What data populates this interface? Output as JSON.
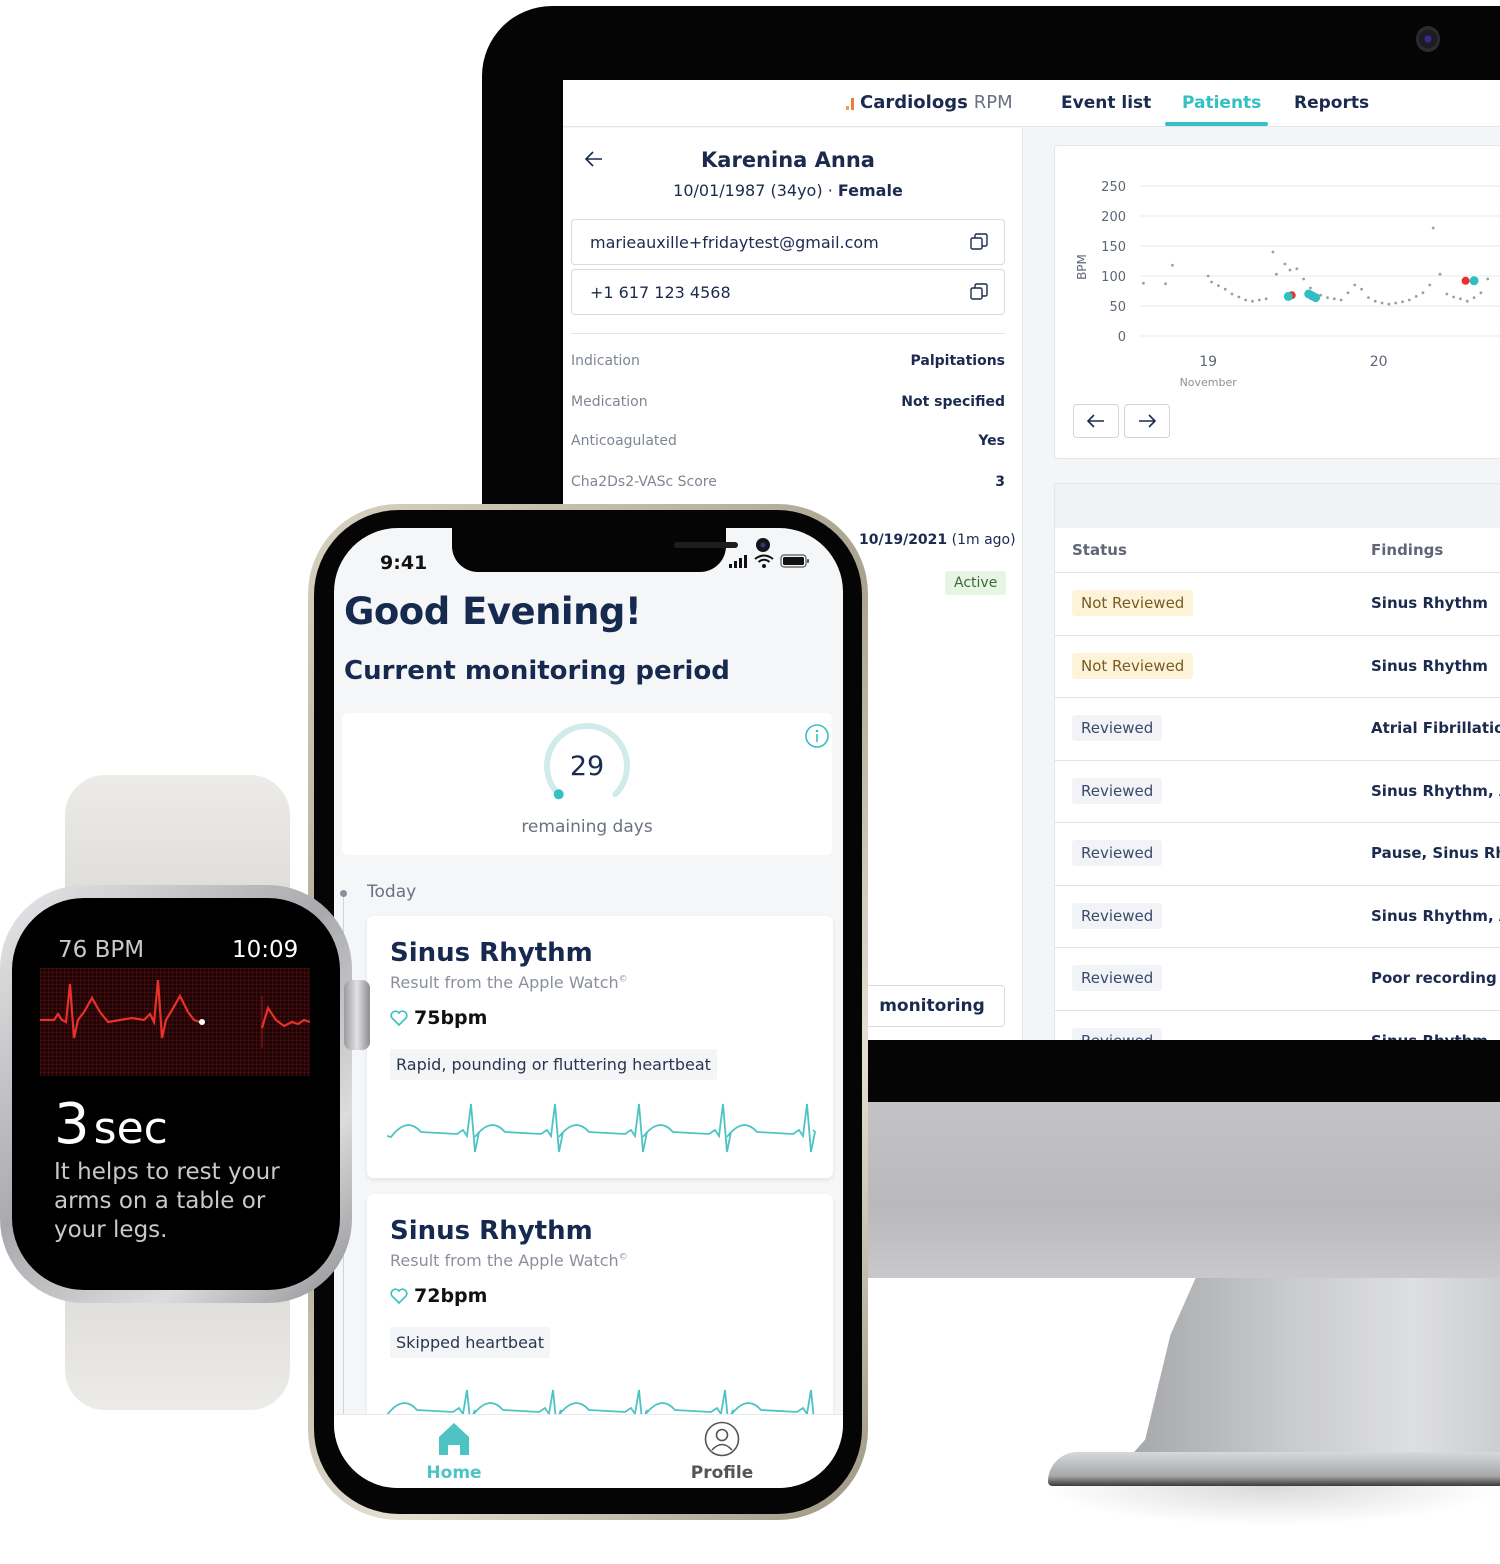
{
  "desktop": {
    "brand": {
      "name": "Cardiologs",
      "suffix": "RPM"
    },
    "nav_tabs": [
      {
        "label": "Event list",
        "active": false
      },
      {
        "label": "Patients",
        "active": true
      },
      {
        "label": "Reports",
        "active": false
      }
    ],
    "patient": {
      "name": "Karenina Anna",
      "dob": "10/01/1987",
      "age": "(34yo)",
      "separator": "·",
      "sex": "Female",
      "email": "marieauxille+fridaytest@gmail.com",
      "phone": "+1 617 123 4568",
      "details": [
        {
          "label": "Indication",
          "value": "Palpitations"
        },
        {
          "label": "Medication",
          "value": "Not specified"
        },
        {
          "label": "Anticoagulated",
          "value": "Yes"
        },
        {
          "label": "Cha2Ds2-VASc Score",
          "value": "3"
        }
      ],
      "last_date": "10/19/2021",
      "last_date_relative": "(1m ago)",
      "status": "Active",
      "monitoring_button": "monitoring"
    },
    "events_table": {
      "headers": {
        "status": "Status",
        "findings": "Findings"
      },
      "rows": [
        {
          "status": "Not Reviewed",
          "findings": "Sinus Rhythm"
        },
        {
          "status": "Not Reviewed",
          "findings": "Sinus Rhythm"
        },
        {
          "status": "Reviewed",
          "findings": "Atrial Fibrillation,"
        },
        {
          "status": "Reviewed",
          "findings": "Sinus Rhythm, Atr"
        },
        {
          "status": "Reviewed",
          "findings": "Pause, Sinus Rhyt"
        },
        {
          "status": "Reviewed",
          "findings": "Sinus Rhythm, Atr"
        },
        {
          "status": "Reviewed",
          "findings": "Poor recording"
        },
        {
          "status": "Reviewed",
          "findings": "Sinus Rhythm"
        }
      ]
    }
  },
  "chart_data": {
    "type": "scatter",
    "title": "",
    "ylabel": "BPM",
    "xlabel": "November",
    "ylim": [
      0,
      250
    ],
    "yticks": [
      0,
      50,
      100,
      150,
      200,
      250
    ],
    "xticks": [
      {
        "label": "19",
        "sublabel": "November",
        "day": 19
      },
      {
        "label": "20",
        "sublabel": "",
        "day": 20
      }
    ],
    "xlim": [
      18.6,
      20.8
    ],
    "grid": true,
    "series": [
      {
        "name": "heart-rate-samples",
        "color": "#9a9ea6",
        "points": [
          [
            18.62,
            88
          ],
          [
            18.75,
            87
          ],
          [
            18.79,
            118
          ],
          [
            19.0,
            100
          ],
          [
            19.02,
            90
          ],
          [
            19.06,
            84
          ],
          [
            19.1,
            78
          ],
          [
            19.14,
            70
          ],
          [
            19.18,
            65
          ],
          [
            19.22,
            60
          ],
          [
            19.26,
            58
          ],
          [
            19.3,
            60
          ],
          [
            19.34,
            62
          ],
          [
            19.38,
            140
          ],
          [
            19.4,
            103
          ],
          [
            19.45,
            120
          ],
          [
            19.48,
            110
          ],
          [
            19.52,
            112
          ],
          [
            19.56,
            95
          ],
          [
            19.6,
            80
          ],
          [
            19.66,
            68
          ],
          [
            19.7,
            64
          ],
          [
            19.74,
            62
          ],
          [
            19.78,
            60
          ],
          [
            19.82,
            72
          ],
          [
            19.86,
            85
          ],
          [
            19.9,
            78
          ],
          [
            19.94,
            64
          ],
          [
            19.98,
            58
          ],
          [
            20.02,
            55
          ],
          [
            20.06,
            53
          ],
          [
            20.1,
            55
          ],
          [
            20.14,
            57
          ],
          [
            20.18,
            60
          ],
          [
            20.22,
            66
          ],
          [
            20.26,
            72
          ],
          [
            20.3,
            85
          ],
          [
            20.32,
            180
          ],
          [
            20.36,
            103
          ],
          [
            20.4,
            70
          ],
          [
            20.44,
            65
          ],
          [
            20.48,
            62
          ],
          [
            20.52,
            58
          ],
          [
            20.56,
            64
          ],
          [
            20.6,
            72
          ],
          [
            20.64,
            95
          ]
        ]
      },
      {
        "name": "abnormal-events",
        "color": "#e8312a",
        "points": [
          [
            19.49,
            68
          ],
          [
            20.51,
            92
          ]
        ]
      },
      {
        "name": "recorded-ecgs",
        "color": "#2fbfc3",
        "points": [
          [
            19.47,
            66
          ],
          [
            19.59,
            70
          ],
          [
            19.61,
            67
          ],
          [
            19.63,
            64
          ],
          [
            20.56,
            92
          ]
        ]
      }
    ]
  },
  "phone": {
    "status_time": "9:41",
    "greeting": "Good Evening!",
    "period_title": "Current monitoring period",
    "remaining_days": "29",
    "remaining_label": "remaining days",
    "remaining_fraction": 0.97,
    "timeline_label": "Today",
    "events": [
      {
        "title": "Sinus Rhythm",
        "source": "Result from the Apple Watch",
        "source_mark": "©",
        "bpm": "75bpm",
        "symptom": "Rapid, pounding or fluttering heartbeat"
      },
      {
        "title": "Sinus Rhythm",
        "source": "Result from the Apple Watch",
        "source_mark": "©",
        "bpm": "72bpm",
        "symptom": "Skipped heartbeat"
      }
    ],
    "tabs": [
      {
        "label": "Home",
        "active": true
      },
      {
        "label": "Profile",
        "active": false
      }
    ]
  },
  "watch": {
    "bpm": "76 BPM",
    "time": "10:09",
    "countdown_value": "3",
    "countdown_unit": "sec",
    "hint": "It helps to rest your arms on a table or your legs."
  },
  "colors": {
    "accent": "#35c0c4",
    "navy": "#16294f",
    "brand_orange": "#f07d34",
    "ecg_red": "#e8312a"
  }
}
